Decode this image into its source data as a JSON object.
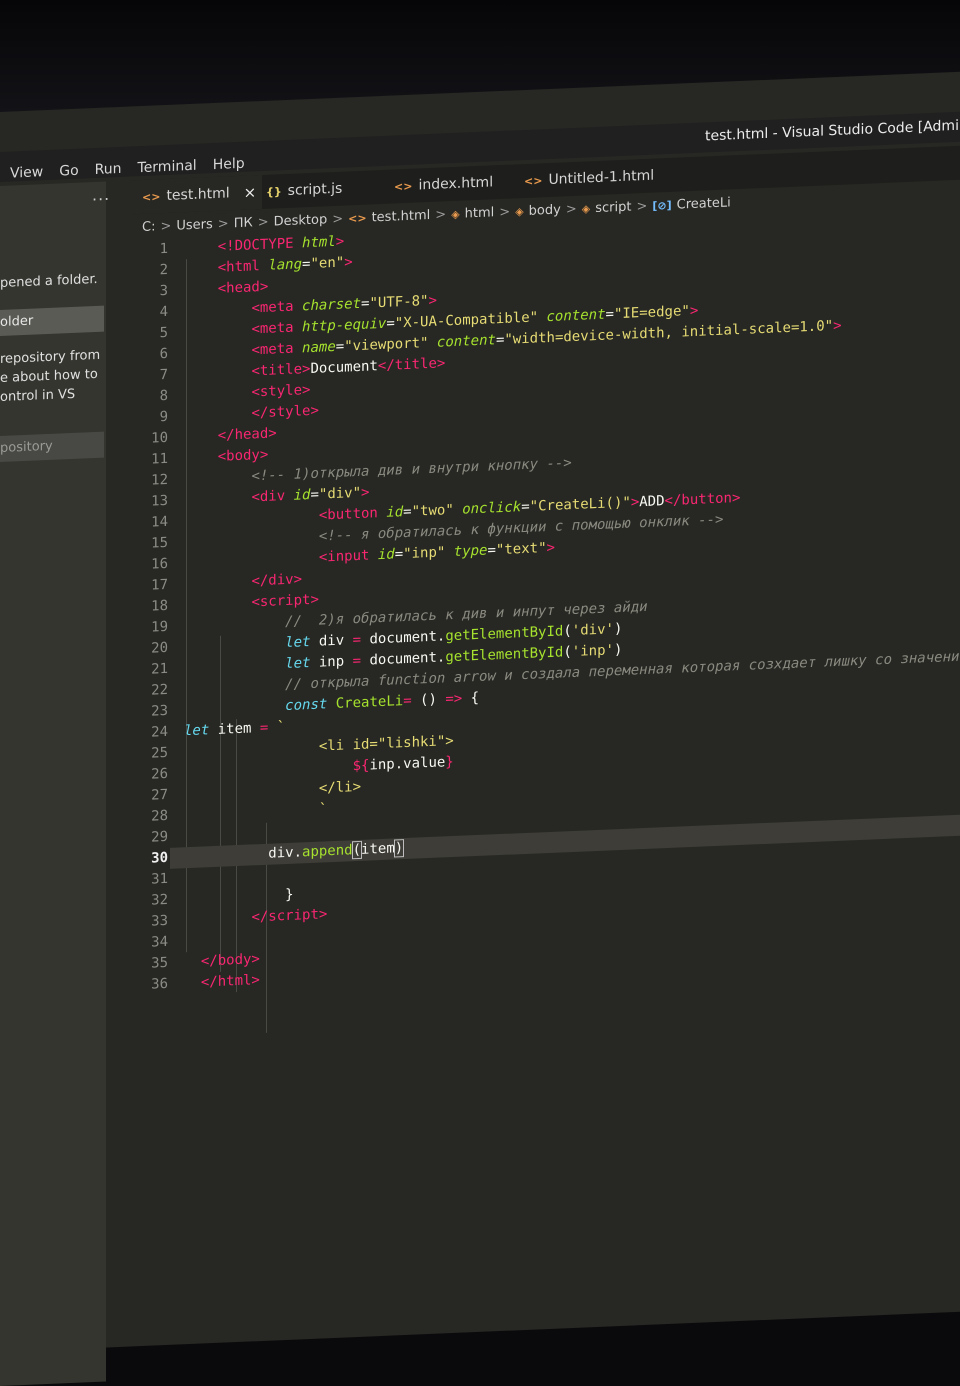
{
  "window": {
    "title": "test.html - Visual Studio Code [Administra"
  },
  "menu": [
    "View",
    "Go",
    "Run",
    "Terminal",
    "Help"
  ],
  "sidebar": {
    "dots": "···",
    "opened_text": "pened a folder.",
    "folder_button": "older",
    "repo_text_1": "repository from",
    "repo_text_2": "e about how to",
    "repo_text_3": "ontrol in VS",
    "repo_button": "pository"
  },
  "tabs": [
    {
      "label": "test.html",
      "icon": "<>",
      "active": true
    },
    {
      "label": "script.js",
      "icon": "{}",
      "active": false
    },
    {
      "label": "index.html",
      "icon": "<>",
      "active": false
    },
    {
      "label": "Untitled-1.html",
      "icon": "<>",
      "active": false
    }
  ],
  "tab_close": "×",
  "breadcrumb": [
    "C:",
    "Users",
    "ПК",
    "Desktop",
    "test.html",
    "html",
    "body",
    "script",
    "CreateLi"
  ],
  "editor": {
    "current_line": 30,
    "line_count": 36
  }
}
